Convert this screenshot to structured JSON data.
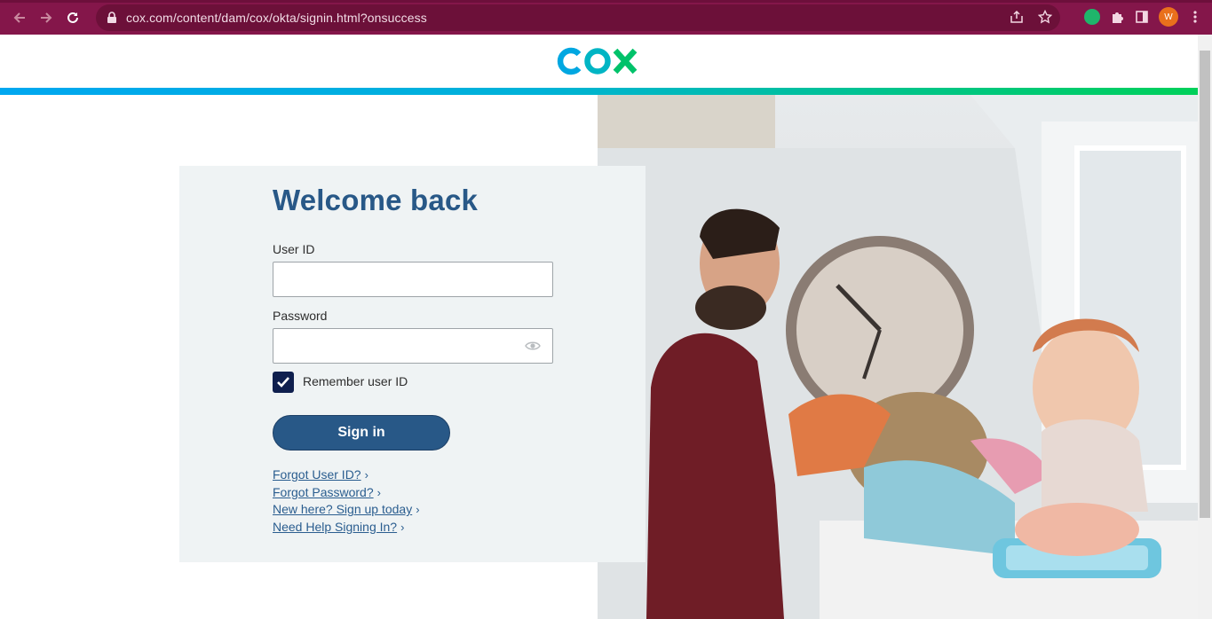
{
  "browser": {
    "url": "cox.com/content/dam/cox/okta/signin.html?onsuccess",
    "profile_initial": "W"
  },
  "brand": {
    "name": "COX",
    "colors": {
      "accent": "#285887",
      "logo_blue": "#00a7e1",
      "logo_green": "#00c26a",
      "chrome": "#84164a"
    }
  },
  "login": {
    "title": "Welcome back",
    "user_label": "User ID",
    "user_value": "",
    "password_label": "Password",
    "password_value": "",
    "remember_label": "Remember user ID",
    "remember_checked": true,
    "signin_label": "Sign in"
  },
  "links": [
    {
      "text": "Forgot User ID?",
      "chevron": "›"
    },
    {
      "text": "Forgot Password?",
      "chevron": "›"
    },
    {
      "text": "New here? Sign up today",
      "chevron": "›"
    },
    {
      "text": "Need Help Signing In?",
      "chevron": "›"
    }
  ],
  "icons": {
    "back": "arrow-left-icon",
    "forward": "arrow-right-icon",
    "reload": "reload-icon",
    "lock": "lock-icon",
    "share": "share-icon",
    "star": "star-icon",
    "extension": "puzzle-icon",
    "sidepanel": "sidepanel-icon",
    "menu": "kebab-menu-icon",
    "eye": "eye-icon",
    "check": "checkmark-icon"
  }
}
